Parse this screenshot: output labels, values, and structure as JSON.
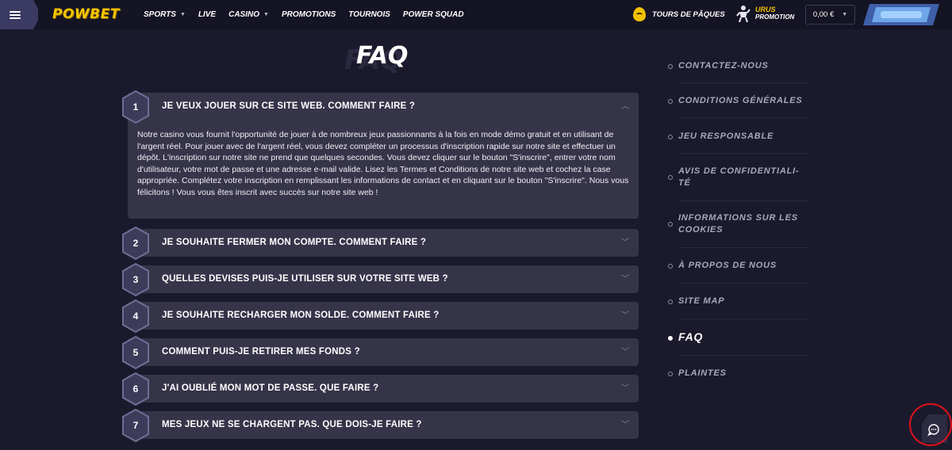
{
  "header": {
    "logo": "POWBET",
    "nav": [
      {
        "label": "SPORTS",
        "dropdown": true
      },
      {
        "label": "LIVE",
        "dropdown": false
      },
      {
        "label": "CASINO",
        "dropdown": true
      },
      {
        "label": "PROMOTIONS",
        "dropdown": false
      },
      {
        "label": "TOURNOIS",
        "dropdown": false
      },
      {
        "label": "POWER SQUAD",
        "dropdown": false
      }
    ],
    "promo_easter": "TOURS DE PÂQUES",
    "promo_urus_title": "URUS",
    "promo_urus_sub": "PROMOTION",
    "balance": "0,00 €"
  },
  "page": {
    "title": "FAQ",
    "title_shadow": "FAQ"
  },
  "faq": [
    {
      "num": "1",
      "question": "JE VEUX JOUER SUR CE SITE WEB. COMMENT FAIRE ?",
      "expanded": true,
      "answer": "Notre casino vous fournit l'opportunité de jouer à de nombreux jeux passionnants à la fois en mode démo gratuit et en utilisant de l'argent réel. Pour jouer avec de l'argent réel, vous devez compléter un processus d'inscription rapide sur notre site et effectuer un dépôt. L'inscription sur notre site ne prend que quelques secondes. Vous devez cliquer sur le bouton \"S'inscrire\", entrer votre nom d'utilisateur, votre mot de passe et une adresse e-mail valide. Lisez les Termes et Conditions de notre site web et cochez la case appropriée. Complétez votre inscription en remplissant les informations de contact et en cliquant sur le bouton \"S'inscrire\". Nous vous félicitons ! Vous vous êtes inscrit avec succès sur notre site web !"
    },
    {
      "num": "2",
      "question": "JE SOUHAITE FERMER MON COMPTE. COMMENT FAIRE ?",
      "expanded": false
    },
    {
      "num": "3",
      "question": "QUELLES DEVISES PUIS-JE UTILISER SUR VOTRE SITE WEB ?",
      "expanded": false
    },
    {
      "num": "4",
      "question": "JE SOUHAITE RECHARGER MON SOLDE. COMMENT FAIRE ?",
      "expanded": false
    },
    {
      "num": "5",
      "question": "COMMENT PUIS-JE RETIRER MES FONDS ?",
      "expanded": false
    },
    {
      "num": "6",
      "question": "J'AI OUBLIÉ MON MOT DE PASSE. QUE FAIRE ?",
      "expanded": false
    },
    {
      "num": "7",
      "question": "MES JEUX NE SE CHARGENT PAS. QUE DOIS-JE FAIRE ?",
      "expanded": false
    }
  ],
  "sidebar": [
    {
      "label": "CONTACTEZ-NOUS",
      "active": false
    },
    {
      "label": "CONDITIONS GÉNÉRALES",
      "active": false
    },
    {
      "label": "JEU RESPONSABLE",
      "active": false
    },
    {
      "label": "AVIS DE CONFIDENTIALI-TÉ",
      "active": false
    },
    {
      "label": "INFORMATIONS SUR LES COOKIES",
      "active": false
    },
    {
      "label": "À PROPOS DE NOUS",
      "active": false
    },
    {
      "label": "SITE MAP",
      "active": false
    },
    {
      "label": "FAQ",
      "active": true
    },
    {
      "label": "PLAINTES",
      "active": false
    }
  ],
  "icons": {
    "menu": "hamburger-icon",
    "easter": "egg-icon",
    "urus": "character-icon",
    "chat": "chat-bubble-icon",
    "chevron_up": "chevron-up-icon",
    "chevron_down": "chevron-down-icon"
  },
  "colors": {
    "background": "#1b1a2c",
    "header": "#151424",
    "card": "#363449",
    "logo": "#f5c400",
    "accent_blue": "#3f5fa8",
    "highlight_ring": "#e0111b"
  }
}
